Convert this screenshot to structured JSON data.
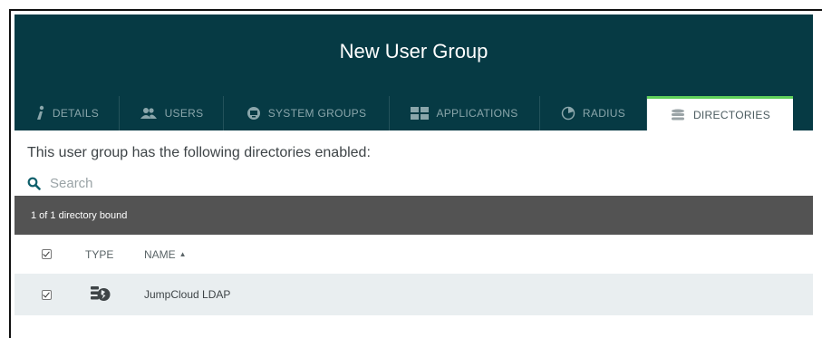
{
  "modal": {
    "title": "New User Group"
  },
  "tabs": [
    {
      "label": "DETAILS",
      "icon": "info-icon",
      "active": false
    },
    {
      "label": "USERS",
      "icon": "users-icon",
      "active": false
    },
    {
      "label": "SYSTEM GROUPS",
      "icon": "system-groups-icon",
      "active": false
    },
    {
      "label": "APPLICATIONS",
      "icon": "applications-icon",
      "active": false
    },
    {
      "label": "RADIUS",
      "icon": "radius-icon",
      "active": false
    },
    {
      "label": "DIRECTORIES",
      "icon": "database-icon",
      "active": true
    }
  ],
  "intro_text": "This user group has the following directories enabled:",
  "search": {
    "placeholder": "Search",
    "icon": "search-icon"
  },
  "bound_status": "1 of 1 directory bound",
  "table": {
    "columns": {
      "type": "TYPE",
      "name": "NAME",
      "sort": "▲"
    },
    "header_checked": true,
    "rows": [
      {
        "checked": true,
        "type_icon": "jumpcloud-ldap-icon",
        "name": "JumpCloud LDAP"
      }
    ]
  },
  "colors": {
    "header_bg": "#063a44",
    "active_tab_accent": "#5fcf5a",
    "status_bar_bg": "#535353",
    "row_bg": "#e9eef0"
  }
}
